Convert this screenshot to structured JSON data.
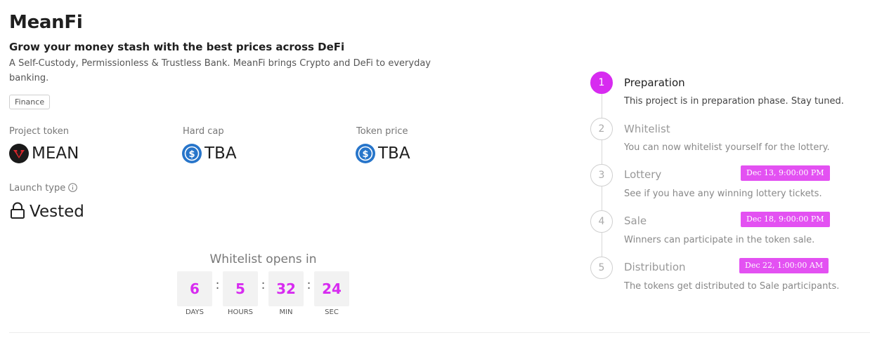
{
  "project": {
    "name": "MeanFi",
    "tagline": "Grow your money stash with the best prices across DeFi",
    "description": "A Self-Custody, Permissionless & Trustless Bank. MeanFi brings Crypto and DeFi to everyday banking.",
    "tag": "Finance"
  },
  "stats": {
    "project_token": {
      "label": "Project token",
      "value": "MEAN",
      "icon": "mean-token-icon"
    },
    "hard_cap": {
      "label": "Hard cap",
      "value": "TBA",
      "icon": "usdc-icon"
    },
    "token_price": {
      "label": "Token price",
      "value": "TBA",
      "icon": "usdc-icon"
    },
    "launch_type": {
      "label": "Launch type",
      "value": "Vested",
      "icon": "lock-icon"
    }
  },
  "countdown": {
    "title": "Whitelist opens in",
    "days": "6",
    "hours": "5",
    "min": "32",
    "sec": "24",
    "days_label": "DAYS",
    "hours_label": "HOURS",
    "min_label": "MIN",
    "sec_label": "SEC",
    "separator": ":"
  },
  "colors": {
    "accent": "#d72bf0",
    "badge": "#e351f2"
  },
  "steps": [
    {
      "number": "1",
      "title": "Preparation",
      "description": "This project is in preparation phase. Stay tuned.",
      "date": "",
      "active": true
    },
    {
      "number": "2",
      "title": "Whitelist",
      "description": "You can now whitelist yourself for the lottery.",
      "date": "",
      "active": false
    },
    {
      "number": "3",
      "title": "Lottery",
      "description": "See if you have any winning lottery tickets.",
      "date": "Dec 13, 9:00:00 PM",
      "active": false
    },
    {
      "number": "4",
      "title": "Sale",
      "description": "Winners can participate in the token sale.",
      "date": "Dec 18, 9:00:00 PM",
      "active": false
    },
    {
      "number": "5",
      "title": "Distribution",
      "description": "The tokens get distributed to Sale participants.",
      "date": "Dec 22, 1:00:00 AM",
      "active": false
    }
  ]
}
